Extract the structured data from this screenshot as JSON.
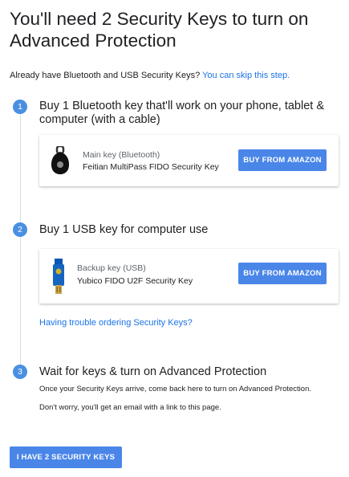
{
  "title": "You'll need 2 Security Keys to turn on Advanced Protection",
  "intro": {
    "text": "Already have Bluetooth and USB Security Keys? ",
    "skip_link": "You can skip this step."
  },
  "steps": [
    {
      "number": "1",
      "title": "Buy 1 Bluetooth key that'll work on your phone, tablet & computer (with a cable)",
      "card": {
        "icon": "bluetooth-key-icon",
        "label": "Main key (Bluetooth)",
        "name": "Feitian MultiPass FIDO Security Key",
        "button": "BUY FROM AMAZON"
      }
    },
    {
      "number": "2",
      "title": "Buy 1 USB key for computer use",
      "card": {
        "icon": "usb-key-icon",
        "label": "Backup key (USB)",
        "name": "Yubico FIDO U2F Security Key",
        "button": "BUY FROM AMAZON"
      }
    },
    {
      "number": "3",
      "title": "Wait for keys & turn on Advanced Protection",
      "paragraphs": [
        "Once your Security Keys arrive, come back here to turn on Advanced Protection.",
        "Don't worry, you'll get an email with a link to this page."
      ]
    }
  ],
  "trouble_link": "Having trouble ordering Security Keys?",
  "main_button": "I HAVE 2 SECURITY KEYS",
  "colors": {
    "accent": "#4a86e8",
    "link": "#1a73e8",
    "step": "#4a90e2"
  }
}
